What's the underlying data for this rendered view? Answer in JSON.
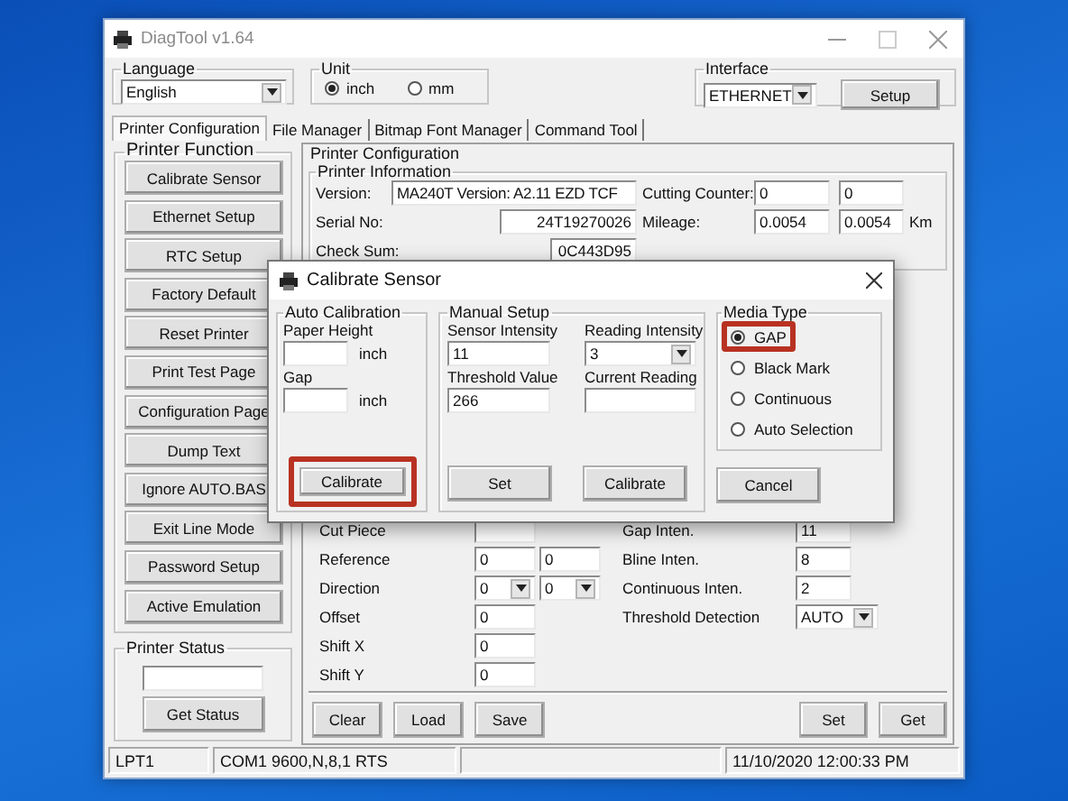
{
  "window": {
    "title": "DiagTool v1.64"
  },
  "language": {
    "label": "Language",
    "value": "English"
  },
  "unit": {
    "label": "Unit",
    "options": [
      {
        "label": "inch",
        "selected": true
      },
      {
        "label": "mm",
        "selected": false
      }
    ]
  },
  "interface": {
    "label": "Interface",
    "value": "ETHERNET",
    "button": "Setup"
  },
  "tabs": [
    {
      "label": "Printer Configuration",
      "selected": true
    },
    {
      "label": "File Manager",
      "selected": false
    },
    {
      "label": "Bitmap Font Manager",
      "selected": false
    },
    {
      "label": "Command Tool",
      "selected": false
    }
  ],
  "printer_function": {
    "title": "Printer Function",
    "buttons": [
      "Calibrate Sensor",
      "Ethernet Setup",
      "RTC Setup",
      "Factory Default",
      "Reset Printer",
      "Print Test Page",
      "Configuration Page",
      "Dump Text",
      "Ignore AUTO.BAS",
      "Exit Line Mode",
      "Password Setup",
      "Active Emulation"
    ]
  },
  "printer_status": {
    "title": "Printer Status",
    "button": "Get Status"
  },
  "printer_configuration": {
    "title": "Printer Configuration",
    "info_title": "Printer Information",
    "version": {
      "label": "Version:",
      "value": "MA240T Version: A2.11 EZD TCF"
    },
    "cutting_counter": {
      "label": "Cutting Counter:",
      "values": [
        "0",
        "0"
      ]
    },
    "serial": {
      "label": "Serial No:",
      "value": "24T19270026"
    },
    "mileage": {
      "label": "Mileage:",
      "values": [
        "0.0054",
        "0.0054"
      ],
      "unit": "Km"
    },
    "check_sum": {
      "label": "Check Sum:",
      "value": "0C443D95"
    },
    "left_rows": [
      {
        "label": "Cut Piece",
        "fields": [
          {
            "kind": "text"
          }
        ]
      },
      {
        "label": "Reference",
        "fields": [
          {
            "kind": "text",
            "value": "0"
          },
          {
            "kind": "text",
            "value": "0"
          }
        ]
      },
      {
        "label": "Direction",
        "fields": [
          {
            "kind": "select",
            "value": "0"
          },
          {
            "kind": "select",
            "value": "0"
          }
        ]
      },
      {
        "label": "Offset",
        "fields": [
          {
            "kind": "text",
            "value": "0"
          }
        ]
      },
      {
        "label": "Shift X",
        "fields": [
          {
            "kind": "text",
            "value": "0"
          }
        ]
      },
      {
        "label": "Shift Y",
        "fields": [
          {
            "kind": "text",
            "value": "0"
          }
        ]
      }
    ],
    "right_rows": [
      {
        "label": "Gap Inten.",
        "fields": [
          {
            "kind": "text",
            "value": "11"
          }
        ]
      },
      {
        "label": "Bline Inten.",
        "fields": [
          {
            "kind": "text",
            "value": "8"
          }
        ]
      },
      {
        "label": "Continuous Inten.",
        "fields": [
          {
            "kind": "text",
            "value": "2"
          }
        ]
      },
      {
        "label": "Threshold Detection",
        "fields": [
          {
            "kind": "select",
            "value": "AUTO"
          }
        ]
      }
    ],
    "left_buttons": [
      "Clear",
      "Load",
      "Save"
    ],
    "right_buttons": [
      "Set",
      "Get"
    ]
  },
  "status_bar": {
    "port": "LPT1",
    "serial": "COM1 9600,N,8,1 RTS",
    "time": "11/10/2020 12:00:33 PM"
  },
  "dialog": {
    "title": "Calibrate Sensor",
    "auto_calibration": {
      "title": "Auto Calibration",
      "fields": [
        {
          "label": "Paper Height",
          "unit": "inch"
        },
        {
          "label": "Gap",
          "unit": "inch"
        }
      ],
      "button": {
        "label": "Calibrate",
        "highlighted": true
      }
    },
    "manual_setup": {
      "title": "Manual Setup",
      "fields": [
        {
          "label": "Sensor Intensity",
          "kind": "text",
          "value": "11"
        },
        {
          "label": "Reading Intensity",
          "kind": "select",
          "value": "3"
        },
        {
          "label": "Threshold Value",
          "kind": "text",
          "value": "266"
        },
        {
          "label": "Current Reading",
          "kind": "text"
        }
      ],
      "buttons": [
        "Set",
        "Calibrate"
      ]
    },
    "media_type": {
      "title": "Media Type",
      "options": [
        {
          "label": "GAP",
          "selected": true,
          "highlighted": true
        },
        {
          "label": "Black Mark",
          "selected": false,
          "highlighted": false
        },
        {
          "label": "Continuous",
          "selected": false,
          "highlighted": false
        },
        {
          "label": "Auto Selection",
          "selected": false,
          "highlighted": false
        }
      ],
      "button": "Cancel"
    }
  }
}
